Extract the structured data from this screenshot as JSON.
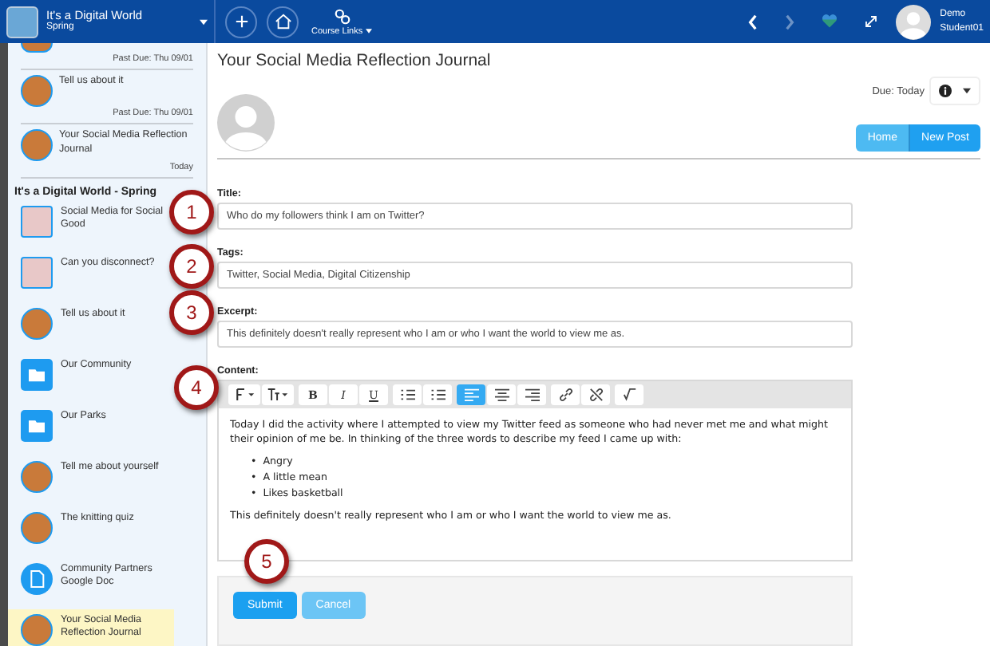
{
  "topbar": {
    "course_title": "It's a Digital World",
    "course_subtitle": "Spring",
    "course_links": "Course Links",
    "nav": [
      {
        "kind": "back",
        "disabled": false
      },
      {
        "kind": "forward",
        "disabled": true
      }
    ],
    "user_first": "Demo",
    "user_last": "Student01"
  },
  "sidebar": {
    "recent": [
      {
        "kind": "cut",
        "due": "Past Due: Thu 09/01"
      },
      {
        "kind": "round",
        "title": "Tell us about it",
        "due": "Past Due: Thu 09/01"
      },
      {
        "kind": "round",
        "title": "Your Social Media Reflection Journal",
        "due": "Today"
      }
    ],
    "section_title": "It's a Digital World - Spring",
    "items": [
      {
        "kind": "square",
        "title": "Social Media for Social Good",
        "selected": false
      },
      {
        "kind": "square",
        "title": "Can you disconnect?",
        "selected": false
      },
      {
        "kind": "round",
        "title": "Tell us about it",
        "selected": false
      },
      {
        "kind": "folder",
        "title": "Our Community",
        "selected": false
      },
      {
        "kind": "folder",
        "title": "Our Parks",
        "selected": false
      },
      {
        "kind": "round",
        "title": "Tell me about yourself",
        "selected": false
      },
      {
        "kind": "round",
        "title": "The knitting quiz",
        "selected": false
      },
      {
        "kind": "document",
        "title": "Community Partners Google Doc",
        "selected": false
      },
      {
        "kind": "round",
        "title": "Your Social Media Reflection Journal",
        "selected": true
      }
    ]
  },
  "page": {
    "title": "Your Social Media Reflection Journal",
    "due": "Due: Today",
    "buttons": [
      {
        "label": "Home",
        "selected": false
      },
      {
        "label": "New Post",
        "selected": true
      }
    ]
  },
  "form": {
    "fields": [
      {
        "label": "Title:",
        "value": "Who do my followers think I am on Twitter?"
      },
      {
        "label": "Tags:",
        "value": "Twitter, Social Media, Digital Citizenship"
      },
      {
        "label": "Excerpt:",
        "value": "This definitely doesn't really represent who I am or who I want the world to view me as."
      }
    ],
    "content_label": "Content:",
    "toolbar": [
      [
        {
          "kind": "font",
          "selected": false
        },
        {
          "kind": "size",
          "selected": false
        }
      ],
      [
        {
          "kind": "bold",
          "label": "B",
          "selected": false
        },
        {
          "kind": "italic",
          "label": "I",
          "selected": false
        },
        {
          "kind": "underline",
          "label": "U",
          "selected": false
        }
      ],
      [
        {
          "kind": "bullets",
          "selected": false
        },
        {
          "kind": "numbers",
          "selected": false
        }
      ],
      [
        {
          "kind": "align-left",
          "selected": true
        },
        {
          "kind": "align-center",
          "selected": false
        },
        {
          "kind": "align-right",
          "selected": false
        }
      ],
      [
        {
          "kind": "link",
          "selected": false
        },
        {
          "kind": "unlink",
          "selected": false
        }
      ],
      [
        {
          "kind": "code",
          "selected": false
        }
      ]
    ],
    "content": {
      "intro": "Today I did the activity where I attempted to view my Twitter feed as someone who had never met me and what might their opinion of me be. In thinking of the three words to describe my feed I came up with:",
      "bullet_marker": "•",
      "bullets": [
        "Angry",
        "A little mean",
        "Likes basketball"
      ],
      "outro": "This definitely doesn't really represent who I am or who I want the world to view me as."
    },
    "submit": "Submit",
    "cancel": "Cancel"
  },
  "callouts": [
    "1",
    "2",
    "3",
    "4",
    "5"
  ]
}
